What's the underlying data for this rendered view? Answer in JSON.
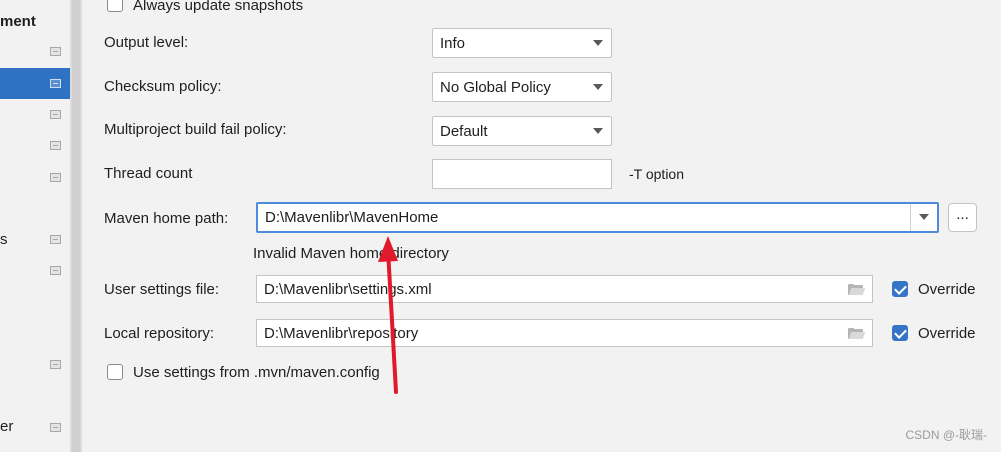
{
  "sidebar": {
    "items": [
      {
        "label": "ment",
        "bold": true
      },
      {
        "label": ""
      },
      {
        "label": ""
      },
      {
        "label": ""
      },
      {
        "label": ""
      },
      {
        "label": ""
      },
      {
        "label": "s"
      },
      {
        "label": ""
      },
      {
        "label": ""
      },
      {
        "label": "er"
      }
    ]
  },
  "settings": {
    "always_update_snapshots": {
      "label": "Always update snapshots",
      "checked": false
    },
    "output_level": {
      "label": "Output level:",
      "value": "Info"
    },
    "checksum_policy": {
      "label": "Checksum policy:",
      "value": "No Global Policy"
    },
    "multiproject_fail_policy": {
      "label": "Multiproject build fail policy:",
      "value": "Default"
    },
    "thread_count": {
      "label": "Thread count",
      "value": "",
      "hint": "-T option"
    },
    "maven_home": {
      "label": "Maven home path:",
      "value": "D:\\Mavenlibr\\MavenHome",
      "browse_label": "...",
      "error": "Invalid Maven home directory"
    },
    "user_settings": {
      "label": "User settings file:",
      "value": "D:\\Mavenlibr\\settings.xml",
      "override_label": "Override",
      "override_checked": true
    },
    "local_repository": {
      "label": "Local repository:",
      "value": "D:\\Mavenlibr\\repository",
      "override_label": "Override",
      "override_checked": true
    },
    "use_mvn_config": {
      "label": "Use settings from .mvn/maven.config",
      "checked": false
    }
  },
  "watermark": "CSDN @-耿瑞-",
  "colors": {
    "accent": "#3574c6",
    "selection": "#2f72c4",
    "annotation": "#e0192c"
  }
}
